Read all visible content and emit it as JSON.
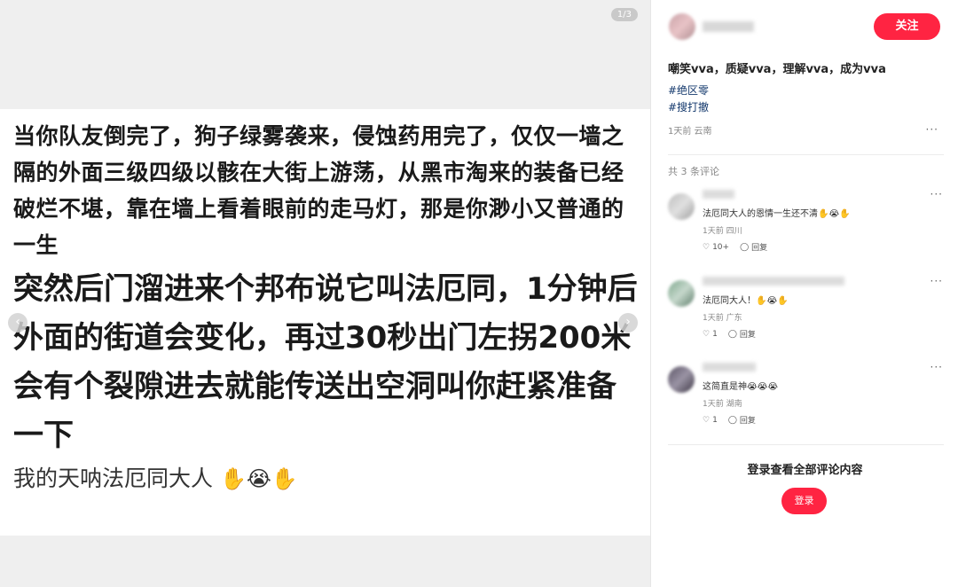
{
  "media": {
    "page_indicator": "1/3",
    "text_block1": "当你队友倒完了，狗子绿雾袭来，侵蚀药用完了，仅仅一墙之隔的外面三级四级以骸在大街上游荡，从黑市淘来的装备已经破烂不堪，靠在墙上看着眼前的走马灯，那是你渺小又普通的一生",
    "text_block2": "突然后门溜进来个邦布说它叫法厄同，1分钟后外面的街道会变化，再过30秒出门左拐200米会有个裂隙进去就能传送出空洞叫你赶紧准备一下",
    "text_block3": "我的天呐法厄同大人",
    "text_block3_emoji": "✋😭✋"
  },
  "side": {
    "follow_label": "关注",
    "title": "嘲笑vva，质疑vva，理解vva，成为vva",
    "tags": [
      "#绝区零",
      "#搜打撤"
    ],
    "meta": "1天前  云南",
    "more": "···",
    "comment_count": "共 3 条评论",
    "comments": [
      {
        "text": "法厄同大人的恩情一生还不清✋😭✋",
        "meta": "1天前  四川",
        "likes": "10+",
        "reply": "回复"
      },
      {
        "text": "法厄同大人！✋😭✋",
        "meta": "1天前  广东",
        "likes": "1",
        "reply": "回复"
      },
      {
        "text": "这简直是神😭😭😭",
        "meta": "1天前  湖南",
        "likes": "1",
        "reply": "回复"
      }
    ],
    "login_prompt": "登录查看全部评论内容",
    "login_label": "登录"
  },
  "colors": {
    "accent": "#ff2442",
    "tag": "#13386c"
  },
  "icons": [
    "chevron-left-icon",
    "chevron-right-icon",
    "heart-icon",
    "comment-icon",
    "more-icon"
  ]
}
